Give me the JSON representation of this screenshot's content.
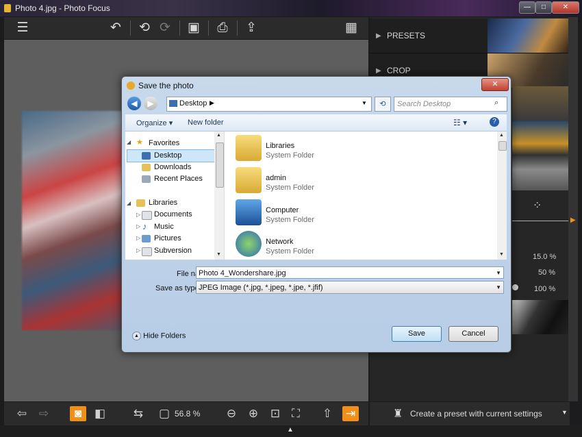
{
  "window": {
    "title": "Photo 4.jpg - Photo Focus"
  },
  "toolbar": {
    "icons": [
      "menu-icon",
      "revert-icon",
      "undo-icon",
      "redo-icon",
      "save-icon",
      "print-icon",
      "share-icon",
      "grid-icon"
    ]
  },
  "right_panel": {
    "presets_label": "PRESETS",
    "crop_label": "CROP",
    "values": [
      "15.0 %",
      "50 %",
      "100 %"
    ]
  },
  "bottom": {
    "zoom": "56.8 %",
    "create_preset_label": "Create a preset with current settings"
  },
  "dialog": {
    "title": "Save the photo",
    "address": "Desktop",
    "search_placeholder": "Search Desktop",
    "organize_label": "Organize",
    "new_folder_label": "New folder",
    "nav": {
      "favorites": "Favorites",
      "desktop": "Desktop",
      "downloads": "Downloads",
      "recent": "Recent Places",
      "libraries": "Libraries",
      "documents": "Documents",
      "music": "Music",
      "pictures": "Pictures",
      "subversion": "Subversion"
    },
    "files": [
      {
        "name": "Libraries",
        "type": "System Folder"
      },
      {
        "name": "admin",
        "type": "System Folder"
      },
      {
        "name": "Computer",
        "type": "System Folder"
      },
      {
        "name": "Network",
        "type": "System Folder"
      }
    ],
    "file_name_label": "File name:",
    "file_name_value": "Photo 4_Wondershare.jpg",
    "save_type_label": "Save as type:",
    "save_type_value": "JPEG Image (*.jpg, *.jpeg, *.jpe, *.jfif)",
    "hide_folders_label": "Hide Folders",
    "save_label": "Save",
    "cancel_label": "Cancel"
  }
}
